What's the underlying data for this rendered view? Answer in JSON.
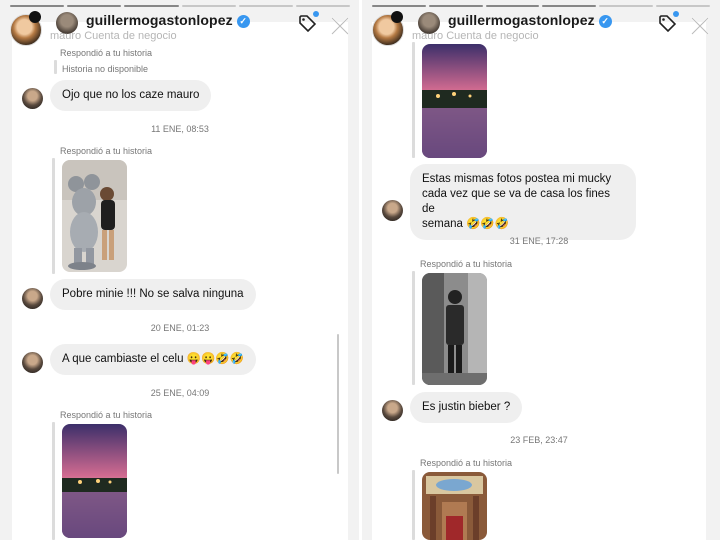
{
  "header": {
    "username": "guillermogastonlopez",
    "ghost_left": "mauro  Cuenta de negocio",
    "ghost_right": "mauro  Cuenta de negocio",
    "verified_glyph": "✓"
  },
  "left": {
    "reply_label_top": "Respondió a tu historia",
    "story_unavailable": "Historia no disponible",
    "msg1": "Ojo que no los caze mauro",
    "ts1": "11 ENE, 08:53",
    "reply_label_2": "Respondió a tu historia",
    "msg2": "Pobre minie !!! No se salva ninguna",
    "ts2": "20 ENE, 01:23",
    "msg3": "A que cambiaste el celu 😛😛🤣🤣",
    "ts3": "25 ENE, 04:09",
    "reply_label_3": "Respondió a tu historia"
  },
  "right": {
    "msg1": "Estas mismas fotos postea mi mucky\ncada vez que se va de casa los fines de\nsemana 🤣🤣🤣",
    "ts1": "31 ENE, 17:28",
    "reply_label_1": "Respondió a tu historia",
    "msg2": "Es justin bieber ?",
    "ts2": "23 FEB, 23:47",
    "reply_label_2": "Respondió a tu historia"
  },
  "icons": {
    "tag": "tag-icon",
    "close": "close-icon"
  },
  "colors": {
    "bubble": "#efefef",
    "verified": "#3897f0",
    "panel_bg": "#f2f2f2"
  }
}
